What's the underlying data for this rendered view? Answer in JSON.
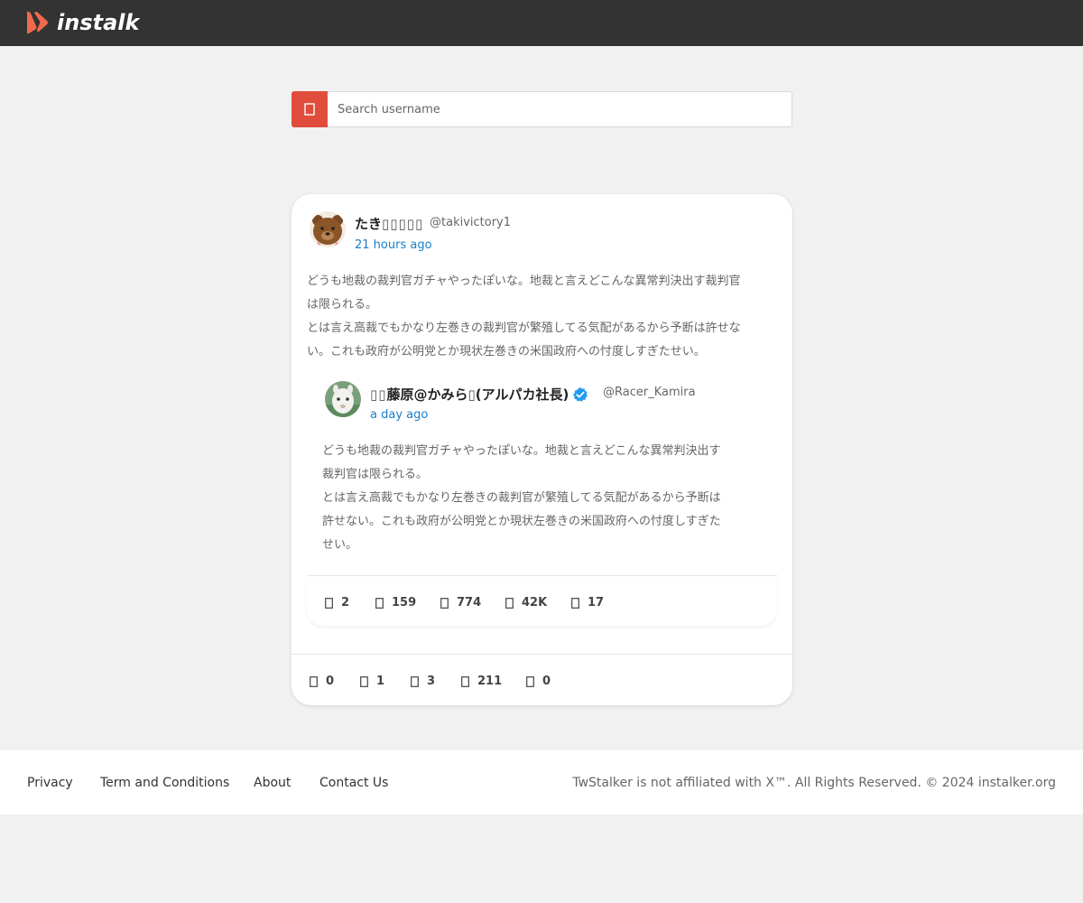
{
  "header": {
    "logo_text": "instalk",
    "brand_color": "#f26a4b",
    "bar_color": "#333333"
  },
  "search": {
    "placeholder": "Search username",
    "button_color": "#e14d3c",
    "icon": "search-icon"
  },
  "post": {
    "author_name": "たき",
    "handle": "@takivictory1",
    "time": "21 hours ago",
    "text_lines": [
      "どうも地裁の裁判官ガチャやったぽいな。地裁と言えどこんな異常判決出す裁判官",
      "は限られる。",
      "とは言え高裁でもかなり左巻きの裁判官が繁殖してる気配があるから予断は許せな",
      "い。これも政府が公明党とか現状左巻きの米国政府への忖度しすぎたせい。"
    ],
    "stats": [
      {
        "icon": "reply-icon",
        "value": "0"
      },
      {
        "icon": "retweet-icon",
        "value": "1"
      },
      {
        "icon": "like-icon",
        "value": "3"
      },
      {
        "icon": "views-icon",
        "value": "211"
      },
      {
        "icon": "bookmark-icon",
        "value": "0"
      }
    ]
  },
  "quoted": {
    "author_name": "藤原@かみら",
    "author_suffix": "(アルパカ社長)",
    "verified": true,
    "verified_color": "#1d9bf0",
    "handle": "@Racer_Kamira",
    "time": "a day ago",
    "text_lines": [
      "どうも地裁の裁判官ガチャやったぽいな。地裁と言えどこんな異常判決出す",
      "裁判官は限られる。",
      "とは言え高裁でもかなり左巻きの裁判官が繁殖してる気配があるから予断は",
      "許せない。これも政府が公明党とか現状左巻きの米国政府への忖度しすぎた",
      "せい。"
    ],
    "stats": [
      {
        "icon": "reply-icon",
        "value": "2"
      },
      {
        "icon": "retweet-icon",
        "value": "159"
      },
      {
        "icon": "like-icon",
        "value": "774"
      },
      {
        "icon": "views-icon",
        "value": "42K"
      },
      {
        "icon": "bookmark-icon",
        "value": "17"
      }
    ]
  },
  "footer": {
    "links": [
      "Privacy",
      "Term and Conditions",
      "About",
      "Contact Us"
    ],
    "copyright": "TwStalker is not affiliated with X™. All Rights Reserved. © 2024 instalker.org"
  }
}
